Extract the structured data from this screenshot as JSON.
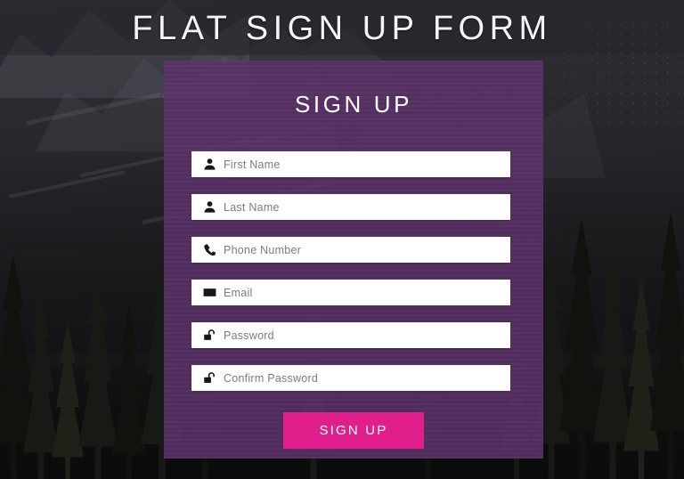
{
  "page": {
    "title": "FLAT SIGN UP FORM",
    "background_description": "dark mountain lake with pine forest photo"
  },
  "form": {
    "heading": "SIGN UP",
    "panel_color": "#5c326a",
    "fields": [
      {
        "name": "first-name",
        "icon": "user-icon",
        "placeholder": "First Name",
        "value": ""
      },
      {
        "name": "last-name",
        "icon": "user-icon",
        "placeholder": "Last Name",
        "value": ""
      },
      {
        "name": "phone-number",
        "icon": "phone-icon",
        "placeholder": "Phone Number",
        "value": ""
      },
      {
        "name": "email",
        "icon": "envelope-icon",
        "placeholder": "Email",
        "value": ""
      },
      {
        "name": "password",
        "icon": "unlock-icon",
        "placeholder": "Password",
        "value": ""
      },
      {
        "name": "confirm-password",
        "icon": "unlock-icon",
        "placeholder": "Confirm Password",
        "value": ""
      }
    ],
    "submit": {
      "label": "SIGN UP",
      "color": "#e01f8c",
      "text_color": "#ffffff"
    }
  },
  "colors": {
    "title_text": "#f2f4f8",
    "heading_text": "#ffffff",
    "placeholder_text": "#7b7b84",
    "icon": "#171717",
    "field_background": "#ffffff",
    "accent_pink": "#e01f8c",
    "panel_purple": "#5c326a",
    "page_background": "#2c2c30"
  }
}
